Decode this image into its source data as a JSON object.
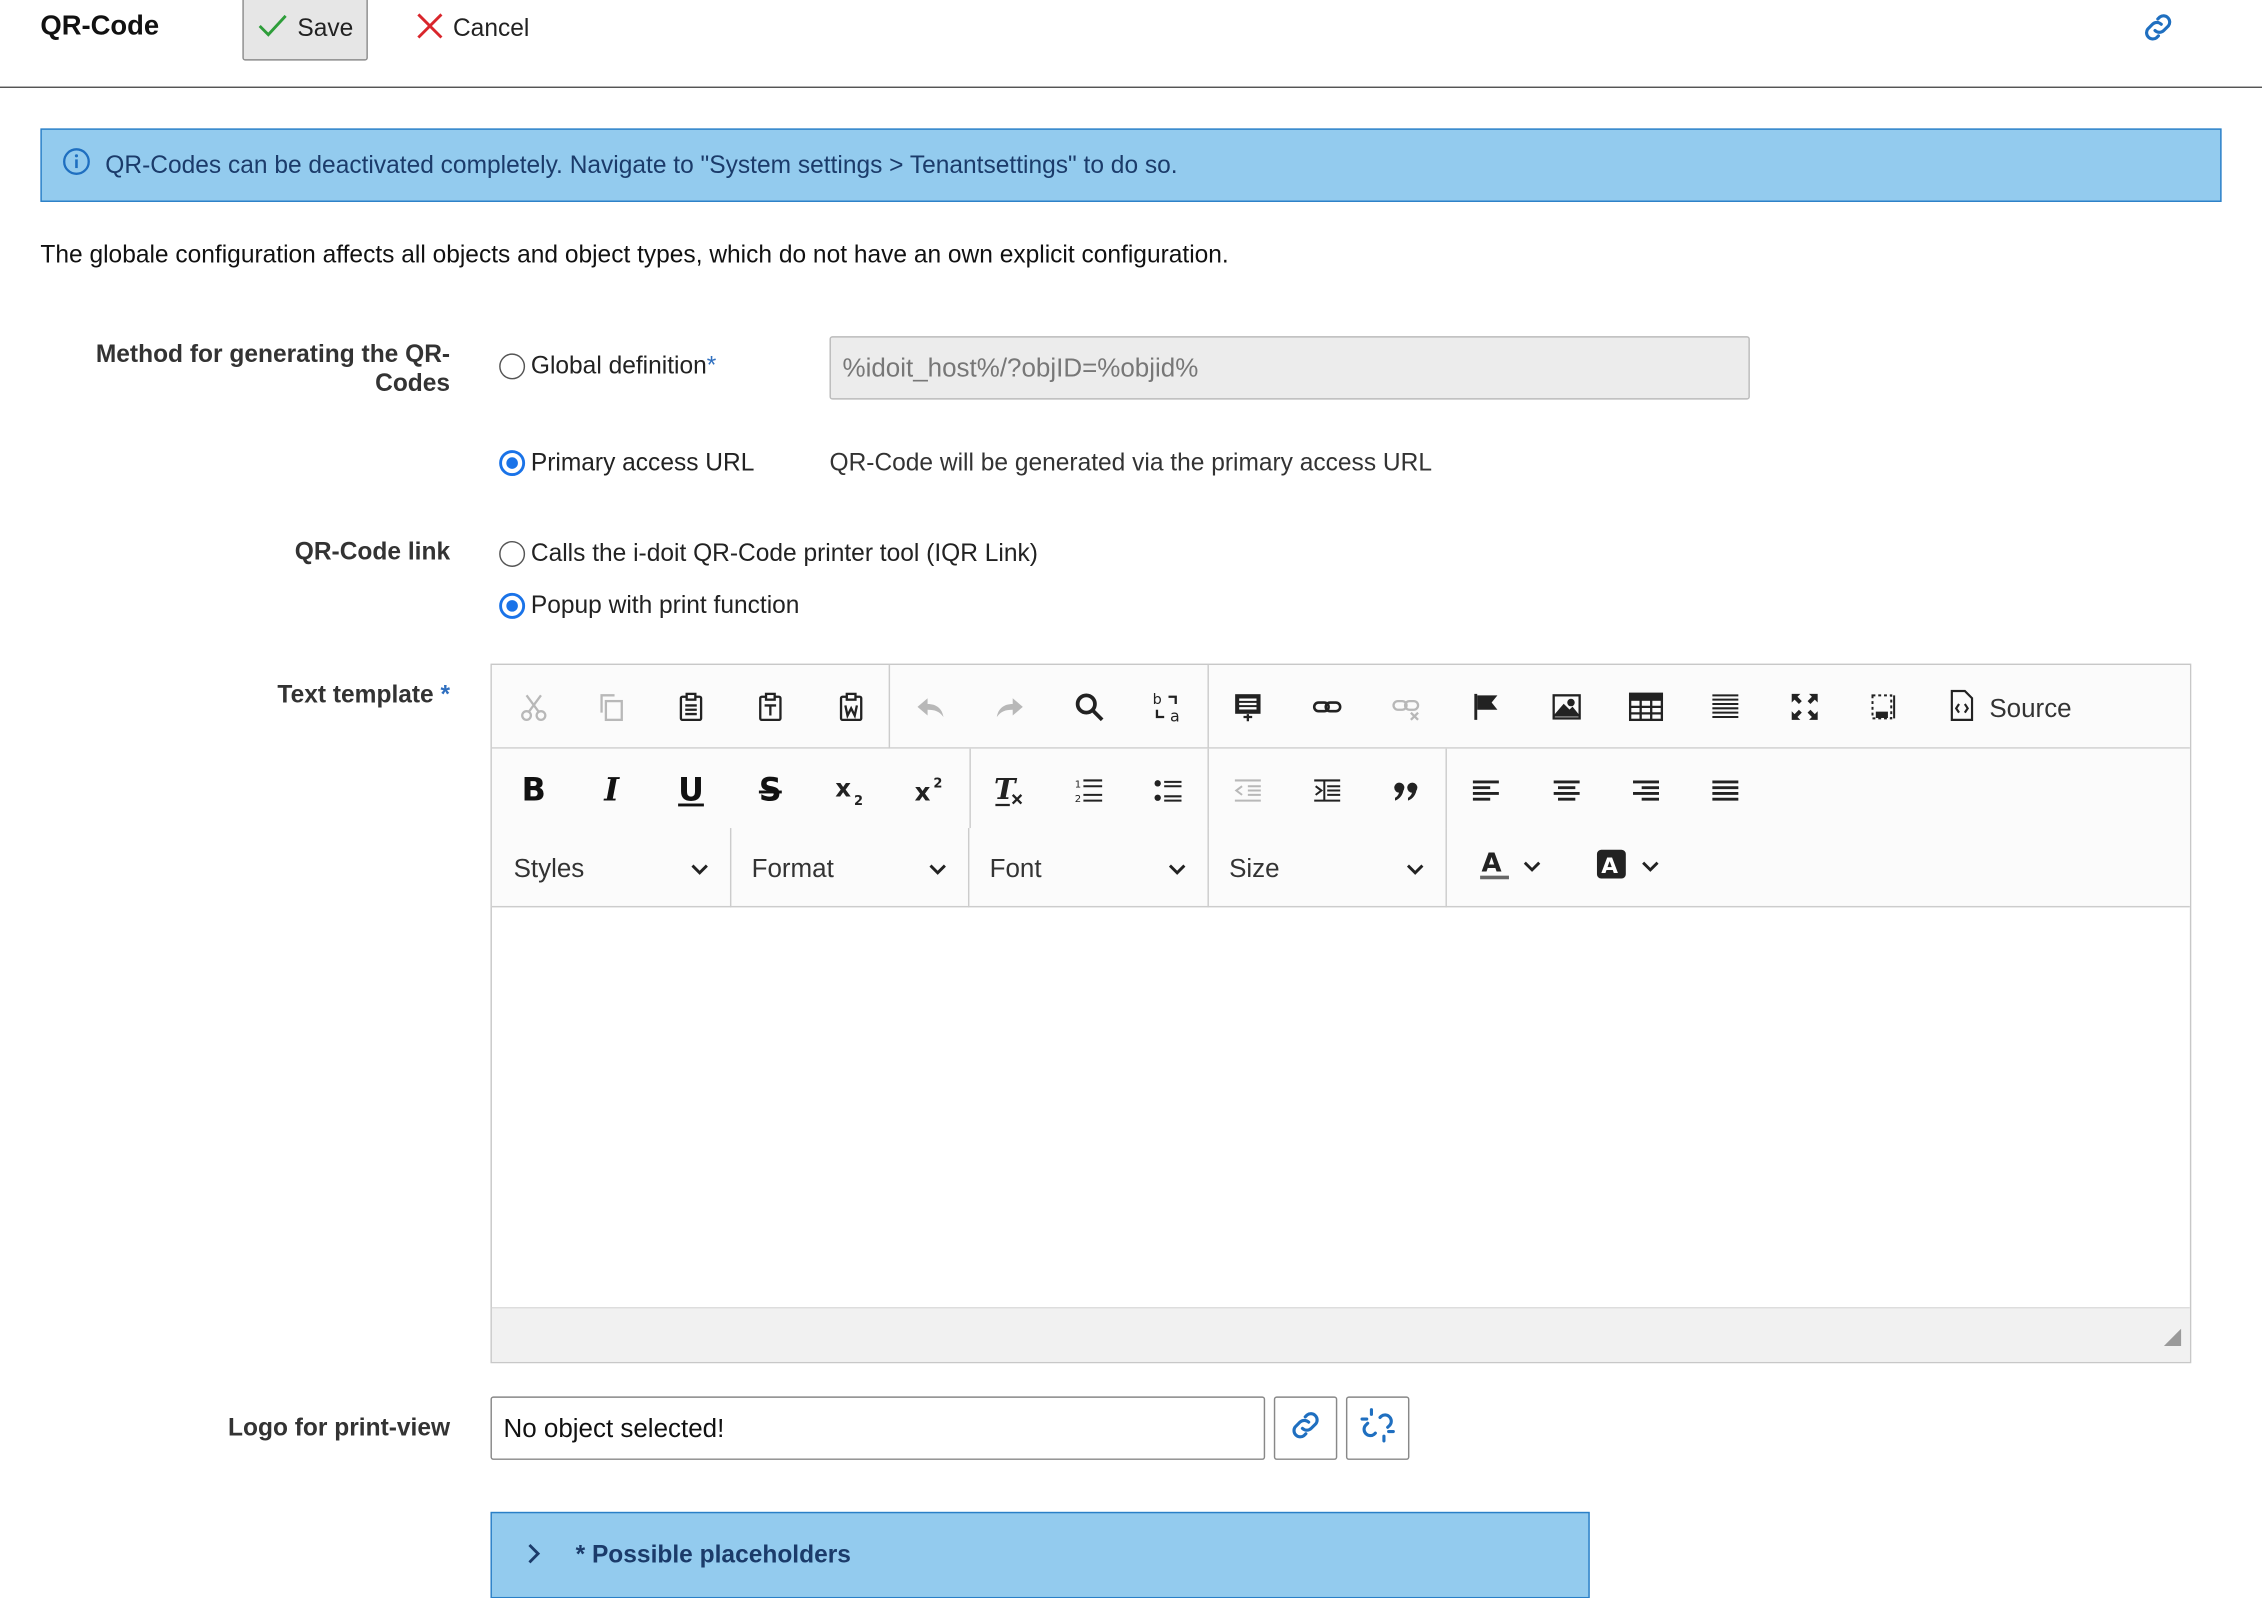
{
  "header": {
    "title": "QR-Code",
    "save_label": "Save",
    "cancel_label": "Cancel"
  },
  "info_banner": "QR-Codes can be deactivated completely. Navigate to \"System settings > Tenantsettings\" to do so.",
  "intro_text": "The globale configuration affects all objects and object types, which do not have an own explicit configuration.",
  "method": {
    "label_line1": "Method for generating the QR-",
    "label_line2": "Codes",
    "global_option": "Global definition",
    "global_required_mark": "*",
    "global_value": "%idoit_host%/?objID=%objid%",
    "primary_option": "Primary access URL",
    "primary_hint": "QR-Code will be generated via the primary access URL",
    "selected": "primary"
  },
  "qr_link": {
    "label": "QR-Code link",
    "option_iqr": "Calls the i-doit QR-Code printer tool (IQR Link)",
    "option_popup": "Popup with print function",
    "selected": "popup"
  },
  "text_template": {
    "label": "Text template",
    "required_mark": "*",
    "source_label": "Source",
    "styles_label": "Styles",
    "format_label": "Format",
    "font_label": "Font",
    "size_label": "Size",
    "content": ""
  },
  "logo": {
    "label": "Logo for print-view",
    "value": "No object selected!"
  },
  "placeholders": {
    "label": "* Possible placeholders"
  },
  "colors": {
    "accent": "#1a73e8",
    "banner_bg": "#93cbee",
    "banner_border": "#2a7fc7",
    "link_icon": "#1f6fc0"
  }
}
